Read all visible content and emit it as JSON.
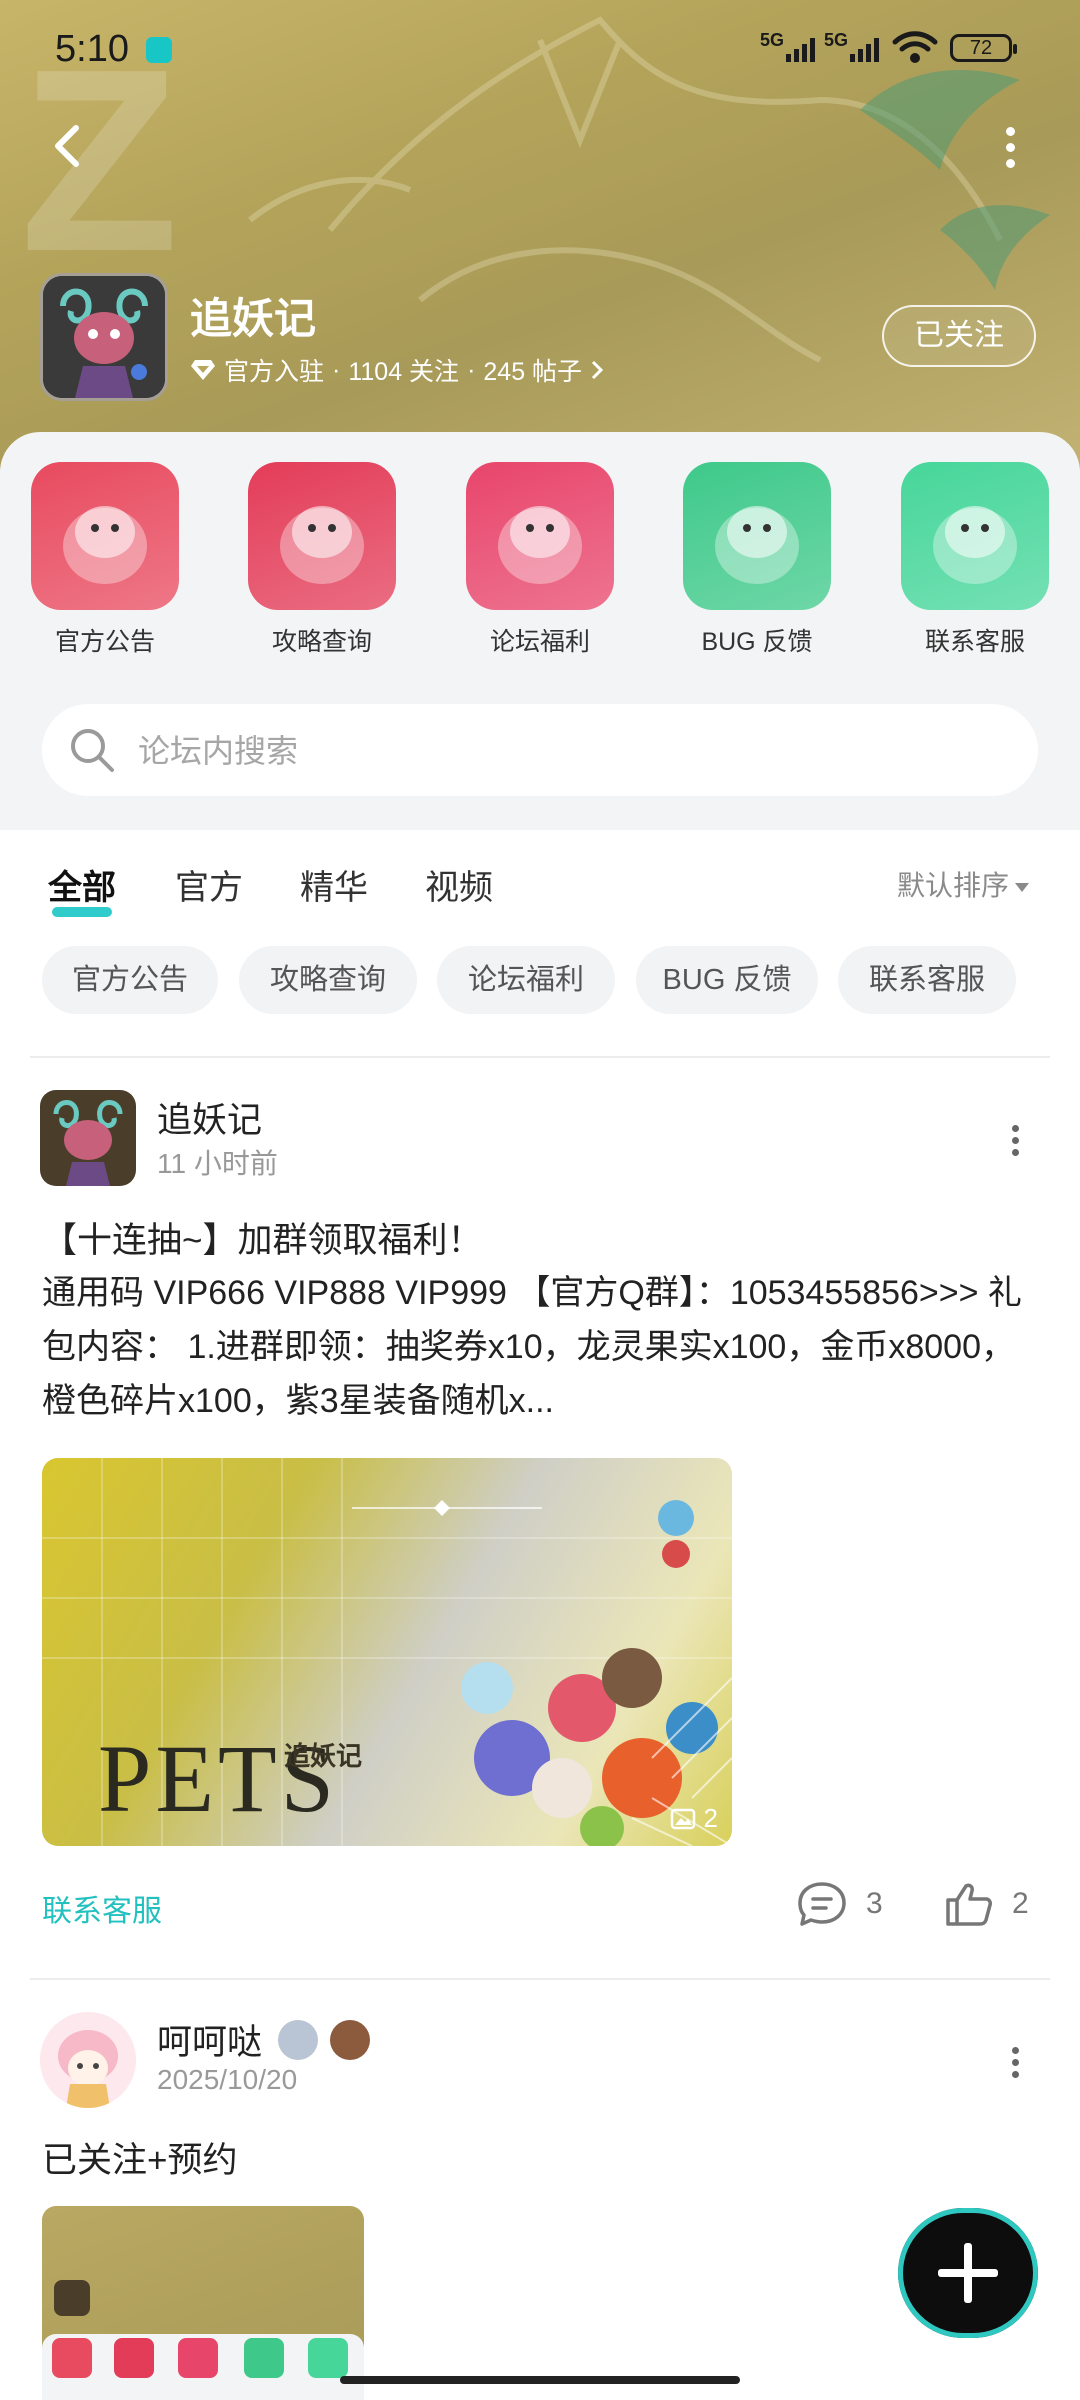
{
  "status_bar": {
    "time": "5:10",
    "net1": "5G",
    "net2": "5G",
    "battery": "72"
  },
  "header": {
    "title": "追妖记",
    "badge_text": "官方入驻",
    "follow_count": "1104 关注",
    "post_count": "245 帖子",
    "sep": "·",
    "follow_button": "已关注"
  },
  "shortcuts": [
    {
      "label": "官方公告",
      "color": "#e84a5f"
    },
    {
      "label": "攻略查询",
      "color": "#e33c58"
    },
    {
      "label": "论坛福利",
      "color": "#e8456b"
    },
    {
      "label": "BUG 反馈",
      "color": "#3ec98a"
    },
    {
      "label": "联系客服",
      "color": "#46d69a"
    }
  ],
  "search": {
    "placeholder": "论坛内搜索"
  },
  "tabs": [
    {
      "label": "全部",
      "active": true
    },
    {
      "label": "官方",
      "active": false
    },
    {
      "label": "精华",
      "active": false
    },
    {
      "label": "视频",
      "active": false
    }
  ],
  "sort_label": "默认排序",
  "chips": [
    "官方公告",
    "攻略查询",
    "论坛福利",
    "BUG 反馈",
    "联系客服"
  ],
  "posts": [
    {
      "author": "追妖记",
      "time": "11 小时前",
      "title": "【十连抽~】加群领取福利！",
      "body": "通用码 VIP666 VIP888 VIP999 【官方Q群】：1053455856>>> 礼包内容： 1.进群即领：抽奖券x10，龙灵果实x100，金币x8000，橙色碎片x100，紫3星装备随机x...",
      "image_text": "PETS",
      "image_logo": "追妖记",
      "image_count": "2",
      "tag": "联系客服",
      "comments": "3",
      "likes": "2"
    },
    {
      "author": "呵呵哒",
      "time": "2025/10/20",
      "title": "已关注+预约"
    }
  ],
  "colors": {
    "accent": "#19c6c6",
    "tag": "#22c0bf"
  }
}
